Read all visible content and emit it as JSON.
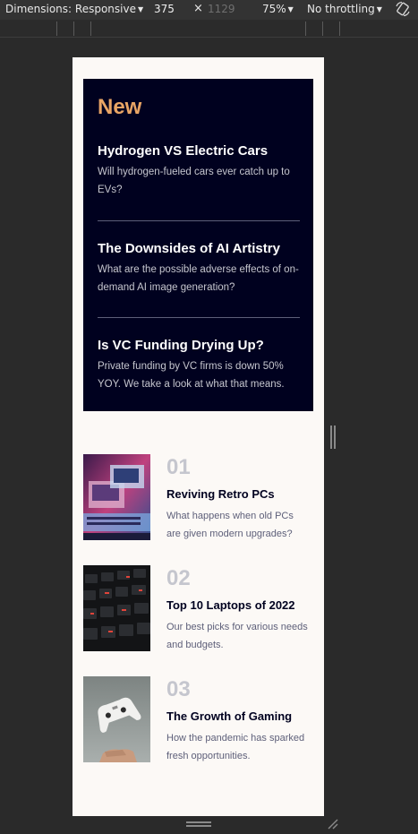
{
  "devtools": {
    "dimensions_label": "Dimensions: Responsive",
    "width": "375",
    "times": "×",
    "height": "1129",
    "zoom": "75%",
    "throttling": "No throttling"
  },
  "new_section": {
    "heading": "New",
    "items": [
      {
        "title": "Hydrogen VS Electric Cars",
        "desc": "Will hydrogen-fueled cars ever catch up to EVs?"
      },
      {
        "title": "The Downsides of AI Artistry",
        "desc": "What are the possible adverse effects of on-demand AI image generation?"
      },
      {
        "title": "Is VC Funding Drying Up?",
        "desc": "Private funding by VC firms is down 50% YOY. We take a look at what that means."
      }
    ]
  },
  "articles": [
    {
      "number": "01",
      "title": "Reviving Retro PCs",
      "desc": "What happens when old PCs are given modern upgrades?"
    },
    {
      "number": "02",
      "title": "Top 10 Laptops of 2022",
      "desc": "Our best picks for various needs and budgets."
    },
    {
      "number": "03",
      "title": "The Growth of Gaming",
      "desc": "How the pandemic has sparked fresh opportunities."
    }
  ]
}
